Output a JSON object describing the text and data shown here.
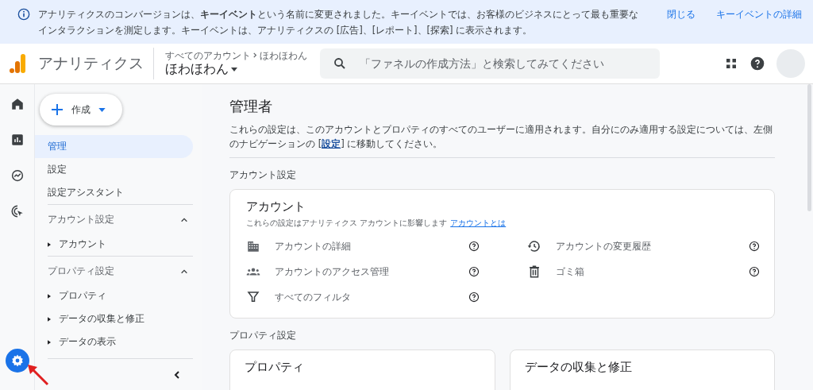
{
  "banner": {
    "text": "アナリティクスのコンバージョンは、**キーイベント**という名前に変更されました。キーイベントでは、お客様のビジネスにとって最も重要なインタラクションを測定します。キーイベントは、アナリティクスの [広告]、[レポート]、[探索] に表示されます。",
    "actions": [
      "閉じる",
      "キーイベントの詳細"
    ]
  },
  "header": {
    "product": "アナリティクス",
    "breadcrumb_parent": "すべてのアカウント",
    "breadcrumb_child": "ほわほわん",
    "account": "ほわほわん",
    "search": {
      "placeholder": "「ファネルの作成方法」と検索してみてください"
    }
  },
  "rail": {
    "items": [
      {
        "kind": "home",
        "selected": false
      },
      {
        "kind": "reports",
        "selected": false
      },
      {
        "kind": "explore",
        "selected": false
      },
      {
        "kind": "advertising",
        "selected": false
      }
    ],
    "settings": {
      "selected": true
    }
  },
  "nav": {
    "create": "作成",
    "items": [
      {
        "label": "管理",
        "selected": true
      },
      {
        "label": "設定",
        "selected": false
      },
      {
        "label": "設定アシスタント",
        "selected": false
      }
    ],
    "sections": [
      {
        "title": "アカウント設定",
        "expanded": true,
        "items": [
          "アカウント"
        ]
      },
      {
        "title": "プロパティ設定",
        "expanded": true,
        "items": [
          "プロパティ",
          "データの収集と修正",
          "データの表示"
        ]
      }
    ]
  },
  "main": {
    "title": "管理者",
    "description_before": "これらの設定は、このアカウントとプロパティのすべてのユーザーに適用されます。自分にのみ適用する設定については、左側のナビゲーションの [",
    "description_link": "設定",
    "description_after": "] に移動してください。",
    "account_section": {
      "heading": "アカウント設定",
      "card": {
        "title": "アカウント",
        "description": "これらの設定はアナリティクス アカウントに影響します",
        "link": "アカウントとは",
        "items": [
          {
            "kind": "building",
            "label": "アカウントの詳細"
          },
          {
            "kind": "history",
            "label": "アカウントの変更履歴"
          },
          {
            "kind": "people",
            "label": "アカウントのアクセス管理"
          },
          {
            "kind": "trash",
            "label": "ゴミ箱"
          },
          {
            "kind": "filter",
            "label": "すべてのフィルタ"
          }
        ]
      }
    },
    "property_section": {
      "heading": "プロパティ設定",
      "cards": [
        {
          "title": "プロパティ"
        },
        {
          "title": "データの収集と修正"
        }
      ]
    }
  }
}
